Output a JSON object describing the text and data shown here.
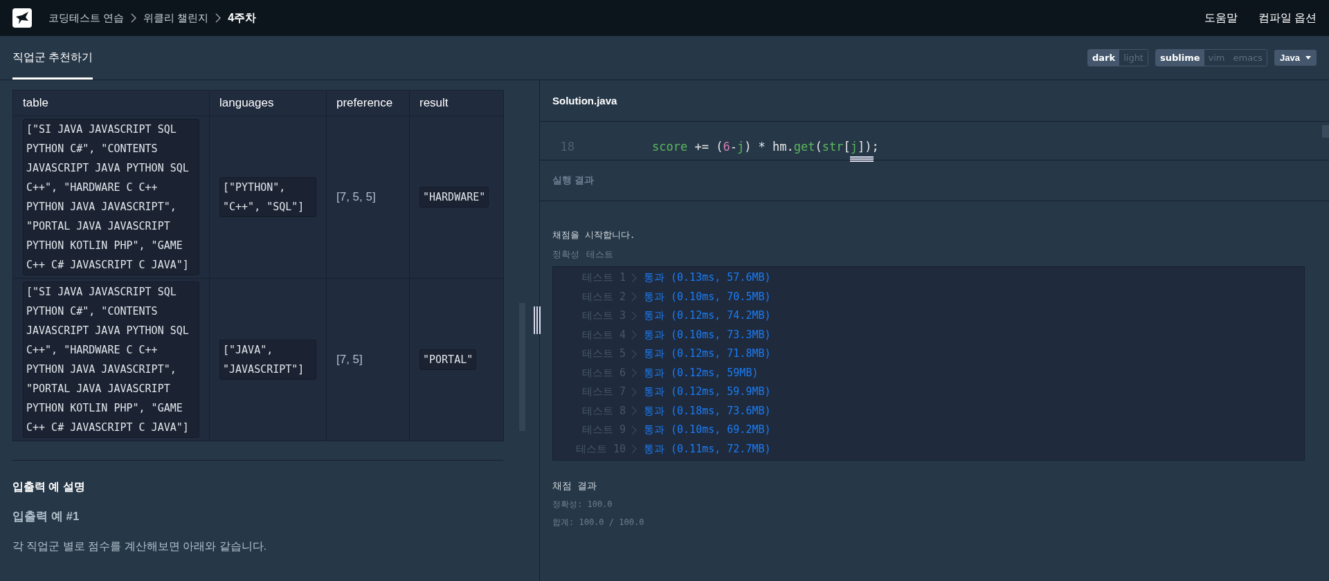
{
  "breadcrumb": [
    {
      "label": "코딩테스트 연습",
      "current": false
    },
    {
      "label": "위클리 챌린지",
      "current": false
    },
    {
      "label": "4주차",
      "current": true
    }
  ],
  "header_links": [
    "도움말",
    "컴파일 옵션"
  ],
  "tabs": [
    {
      "label": "직업군 추천하기",
      "selected": true
    }
  ],
  "theme_toggle": [
    {
      "label": "dark",
      "selected": true
    },
    {
      "label": "light",
      "selected": false
    }
  ],
  "keymap_toggle": [
    {
      "label": "sublime",
      "selected": true
    },
    {
      "label": "vim",
      "selected": false
    },
    {
      "label": "emacs",
      "selected": false
    }
  ],
  "language_menu": {
    "label": "Java"
  },
  "examples_table": {
    "columns": [
      "table",
      "languages",
      "preference",
      "result"
    ],
    "rows": [
      [
        {
          "kind": "code",
          "text": "[\"SI JAVA JAVASCRIPT SQL PYTHON C#\", \"CONTENTS JAVASCRIPT JAVA PYTHON SQL C++\", \"HARDWARE C C++ PYTHON JAVA JAVASCRIPT\", \"PORTAL JAVA JAVASCRIPT PYTHON KOTLIN PHP\", \"GAME C++ C# JAVASCRIPT C JAVA\"]"
        },
        {
          "kind": "code",
          "text": "[\"PYTHON\", \"C++\", \"SQL\"]"
        },
        {
          "kind": "plain",
          "text": "[7, 5, 5]"
        },
        {
          "kind": "code",
          "text": "\"HARDWARE\""
        }
      ],
      [
        {
          "kind": "code",
          "text": "[\"SI JAVA JAVASCRIPT SQL PYTHON C#\", \"CONTENTS JAVASCRIPT JAVA PYTHON SQL C++\", \"HARDWARE C C++ PYTHON JAVA JAVASCRIPT\", \"PORTAL JAVA JAVASCRIPT PYTHON KOTLIN PHP\", \"GAME C++ C# JAVASCRIPT C JAVA\"]"
        },
        {
          "kind": "code",
          "text": "[\"JAVA\", \"JAVASCRIPT\"]"
        },
        {
          "kind": "plain",
          "text": "[7, 5]"
        },
        {
          "kind": "code",
          "text": "\"PORTAL\""
        }
      ]
    ]
  },
  "description": {
    "heading": "입출력 예 설명",
    "subheading": "입출력 예 #1",
    "paragraph": "각 직업군 별로 점수를 계산해보면 아래와 같습니다."
  },
  "editor": {
    "file_name": "Solution.java",
    "lines": [
      {
        "number": "18",
        "tokens": [
          {
            "kind": "ident",
            "text": "score"
          },
          {
            "kind": "plain",
            "text": " += ("
          },
          {
            "kind": "number",
            "text": "6"
          },
          {
            "kind": "plain",
            "text": "-"
          },
          {
            "kind": "ident",
            "text": "j"
          },
          {
            "kind": "plain",
            "text": ") * hm."
          },
          {
            "kind": "ident",
            "text": "get"
          },
          {
            "kind": "plain",
            "text": "("
          },
          {
            "kind": "ident",
            "text": "str"
          },
          {
            "kind": "plain",
            "text": "["
          },
          {
            "kind": "ident",
            "text": "j"
          },
          {
            "kind": "plain",
            "text": "]);"
          }
        ]
      }
    ]
  },
  "results": {
    "title": "실행 결과",
    "intro": "채점을 시작합니다.",
    "group_labels": [
      "정확성",
      "테스트"
    ],
    "tests": [
      {
        "label": "테스트 1",
        "result": "통과 (0.13ms, 57.6MB)",
        "passed": true
      },
      {
        "label": "테스트 2",
        "result": "통과 (0.10ms, 70.5MB)",
        "passed": true
      },
      {
        "label": "테스트 3",
        "result": "통과 (0.12ms, 74.2MB)",
        "passed": true
      },
      {
        "label": "테스트 4",
        "result": "통과 (0.10ms, 73.3MB)",
        "passed": true
      },
      {
        "label": "테스트 5",
        "result": "통과 (0.12ms, 71.8MB)",
        "passed": true
      },
      {
        "label": "테스트 6",
        "result": "통과 (0.12ms, 59MB)",
        "passed": true
      },
      {
        "label": "테스트 7",
        "result": "통과 (0.12ms, 59.9MB)",
        "passed": true
      },
      {
        "label": "테스트 8",
        "result": "통과 (0.18ms, 73.6MB)",
        "passed": true
      },
      {
        "label": "테스트 9",
        "result": "통과 (0.10ms, 69.2MB)",
        "passed": true
      },
      {
        "label": "테스트 10",
        "result": "통과 (0.11ms, 72.7MB)",
        "passed": true
      }
    ],
    "summary_title": "채점 결과",
    "summary_lines": [
      "정확성: 100.0",
      "합계: 100.0 / 100.0"
    ]
  }
}
